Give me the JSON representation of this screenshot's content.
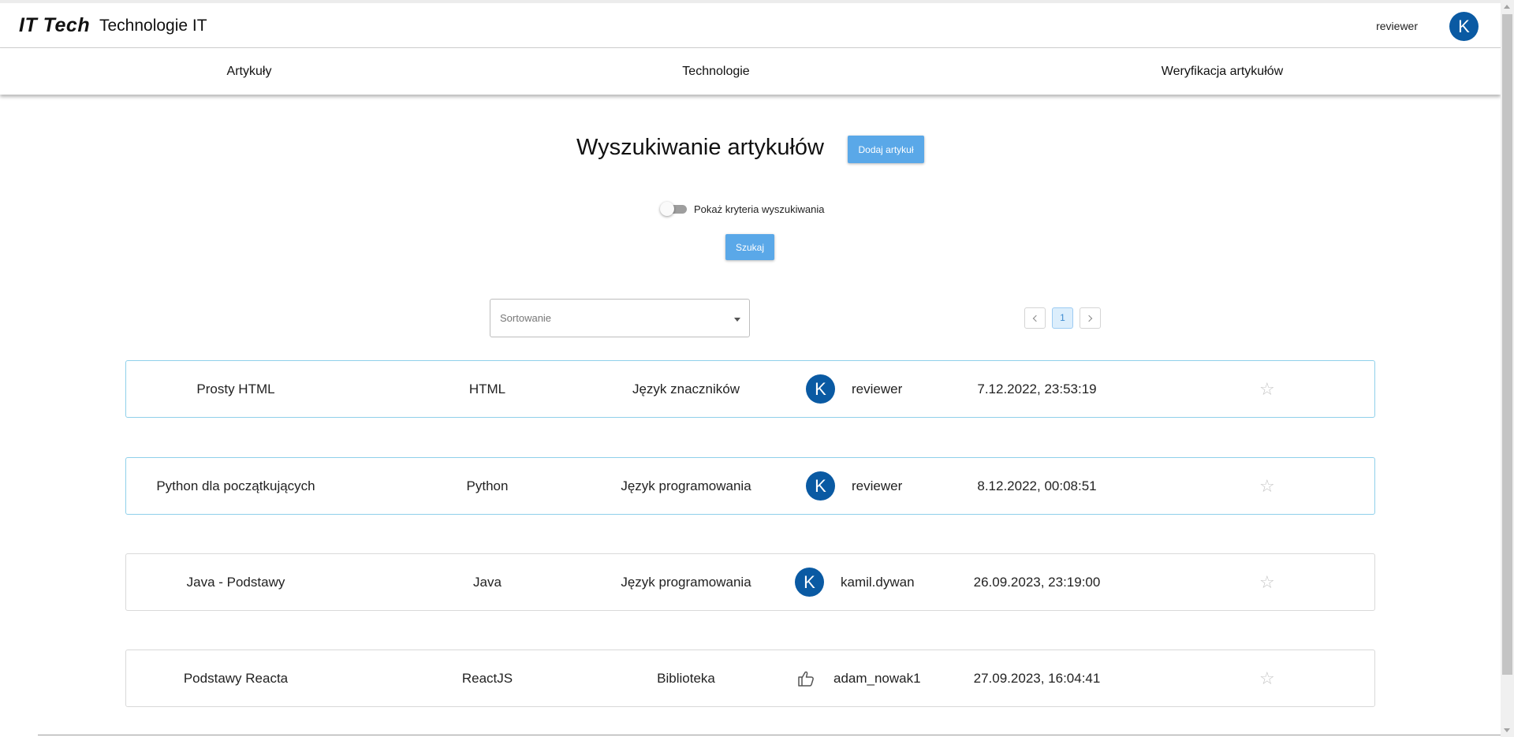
{
  "header": {
    "logo": "IT Tech",
    "title": "Technologie IT",
    "user_name": "reviewer",
    "avatar_letter": "K"
  },
  "nav": {
    "items": [
      {
        "label": "Artykuły"
      },
      {
        "label": "Technologie"
      },
      {
        "label": "Weryfikacja artykułów"
      }
    ]
  },
  "main": {
    "title": "Wyszukiwanie artykułów",
    "add_button": "Dodaj artykuł",
    "toggle_label": "Pokaż kryteria wyszukiwania",
    "toggle_on": false,
    "search_button": "Szukaj",
    "sort_placeholder": "Sortowanie",
    "pagination": {
      "current_page": "1"
    }
  },
  "articles": [
    {
      "title": "Prosty HTML",
      "technology": "HTML",
      "category": "Język znaczników",
      "author_icon": "avatar",
      "avatar_letter": "K",
      "author": "reviewer",
      "date": "7.12.2022, 23:53:19"
    },
    {
      "title": "Python dla początkujących",
      "technology": "Python",
      "category": "Język programowania",
      "author_icon": "avatar",
      "avatar_letter": "K",
      "author": "reviewer",
      "date": "8.12.2022, 00:08:51"
    },
    {
      "title": "Java - Podstawy",
      "technology": "Java",
      "category": "Język programowania",
      "author_icon": "avatar",
      "avatar_letter": "K",
      "author": "kamil.dywan",
      "date": "26.09.2023, 23:19:00"
    },
    {
      "title": "Podstawy Reacta",
      "technology": "ReactJS",
      "category": "Biblioteka",
      "author_icon": "thumbs-up-icon",
      "avatar_letter": "",
      "author": "adam_nowak1",
      "date": "27.09.2023, 16:04:41"
    }
  ],
  "colors": {
    "primary_button": "#5aa8e8",
    "avatar": "#0a5aa3",
    "card_highlight_border": "#8fd0ea"
  }
}
